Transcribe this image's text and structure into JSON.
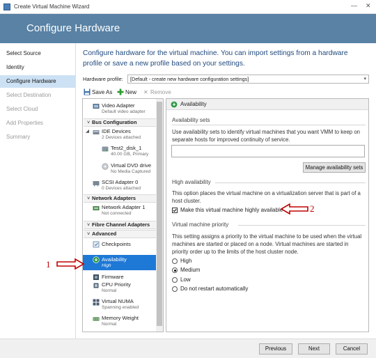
{
  "window": {
    "title": "Create Virtual Machine Wizard"
  },
  "header": {
    "title": "Configure Hardware"
  },
  "nav": {
    "items": [
      {
        "label": "Select Source"
      },
      {
        "label": "Identity"
      },
      {
        "label": "Configure Hardware"
      },
      {
        "label": "Select Destination"
      },
      {
        "label": "Select Cloud"
      },
      {
        "label": "Add Properties"
      },
      {
        "label": "Summary"
      }
    ]
  },
  "intro": {
    "text": "Configure hardware for the virtual machine. You can import settings from a hardware profile or save a new profile based on your settings."
  },
  "hardware_profile": {
    "label": "Hardware profile:",
    "value": "[Default - create new hardware configuration settings]"
  },
  "toolbar": {
    "save_as": "Save As",
    "new": "New",
    "remove": "Remove"
  },
  "tree": {
    "video_adapter": {
      "name": "Video Adapter",
      "sub": "Default video adapter"
    },
    "bus_configuration": "Bus Configuration",
    "ide_devices": {
      "name": "IDE Devices",
      "sub": "2 Devices attached"
    },
    "disk": {
      "name": "Test2_disk_1",
      "sub": "40.00 GB, Primary"
    },
    "dvd": {
      "name": "Virtual DVD drive",
      "sub": "No Media Captured"
    },
    "scsi": {
      "name": "SCSI Adapter 0",
      "sub": "0 Devices attached"
    },
    "network_adapters": "Network Adapters",
    "network_adapter_1": {
      "name": "Network Adapter 1",
      "sub": "Not connected"
    },
    "fibre_channel": "Fibre Channel Adapters",
    "advanced": "Advanced",
    "checkpoints": {
      "name": "Checkpoints"
    },
    "availability": {
      "name": "Availability",
      "sub": "High"
    },
    "firmware": {
      "name": "Firmware"
    },
    "cpu_priority": {
      "name": "CPU Priority",
      "sub": "Normal"
    },
    "virtual_numa": {
      "name": "Virtual NUMA",
      "sub": "Spanning enabled"
    },
    "memory_weight": {
      "name": "Memory Weight",
      "sub": "Normal"
    }
  },
  "panel": {
    "title": "Availability",
    "sets": {
      "heading": "Availability sets",
      "desc": "Use availability sets to identify virtual machines that you want VMM to keep on separate hosts for improved continuity of service.",
      "manage_button": "Manage availability sets"
    },
    "ha": {
      "heading": "High availability",
      "desc": "This option places the virtual machine on a virtualization server that is part of a host cluster.",
      "checkbox_label": "Make this virtual machine highly available",
      "checked": true
    },
    "priority": {
      "heading": "Virtual machine priority",
      "desc": "This setting assigns a priority to the virtual machine to be used when the virtual machines are started or placed on a node. Virtual machines are started in priority order up to the limits of the host cluster node.",
      "options": [
        "High",
        "Medium",
        "Low",
        "Do not restart automatically"
      ],
      "selected": "Medium"
    }
  },
  "footer": {
    "previous": "Previous",
    "next": "Next",
    "cancel": "Cancel"
  },
  "annotations": {
    "one": "1",
    "two": "2"
  },
  "colors": {
    "header": "#5982a5",
    "selection": "#1e78d6",
    "nav_active": "#cde1f4",
    "annotation": "#c00000",
    "intro_text": "#1f497d"
  }
}
